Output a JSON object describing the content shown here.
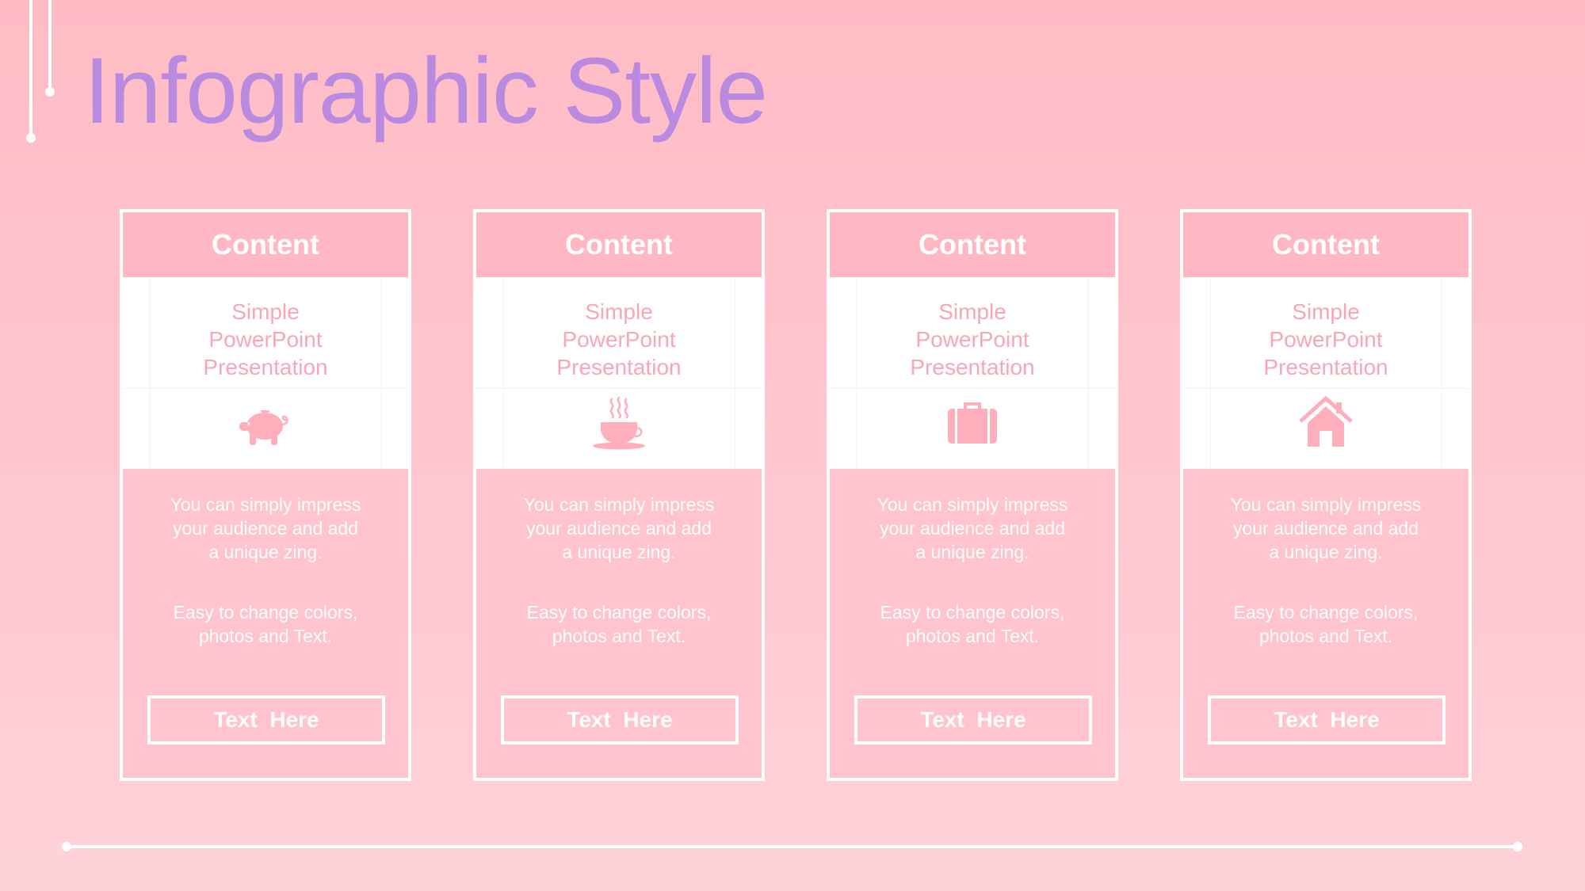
{
  "title": "Infographic Style",
  "colors": {
    "title": "#b98ae0",
    "accent_pink": "#ffb8c3",
    "subtitle_pink": "#f7a7b6",
    "icon_pink": "#ffaebc",
    "line_white": "#ffffff"
  },
  "cards": [
    {
      "header": "Content",
      "subtitle_lines": [
        "Simple",
        "PowerPoint",
        "Presentation"
      ],
      "icon": "piggy-bank-icon",
      "body1_lines": [
        "You can simply impress",
        "your audience and add",
        "a unique zing."
      ],
      "body2_lines": [
        "Easy to change colors,",
        "photos and Text."
      ],
      "button": "Text  Here"
    },
    {
      "header": "Content",
      "subtitle_lines": [
        "Simple",
        "PowerPoint",
        "Presentation"
      ],
      "icon": "coffee-cup-icon",
      "body1_lines": [
        "You can simply impress",
        "your audience and add",
        "a unique zing."
      ],
      "body2_lines": [
        "Easy to change colors,",
        "photos and Text."
      ],
      "button": "Text  Here"
    },
    {
      "header": "Content",
      "subtitle_lines": [
        "Simple",
        "PowerPoint",
        "Presentation"
      ],
      "icon": "briefcase-icon",
      "body1_lines": [
        "You can simply impress",
        "your audience and add",
        "a unique zing."
      ],
      "body2_lines": [
        "Easy to change colors,",
        "photos and Text."
      ],
      "button": "Text  Here"
    },
    {
      "header": "Content",
      "subtitle_lines": [
        "Simple",
        "PowerPoint",
        "Presentation"
      ],
      "icon": "house-icon",
      "body1_lines": [
        "You can simply impress",
        "your audience and add",
        "a unique zing."
      ],
      "body2_lines": [
        "Easy to change colors,",
        "photos and Text."
      ],
      "button": "Text  Here"
    }
  ]
}
